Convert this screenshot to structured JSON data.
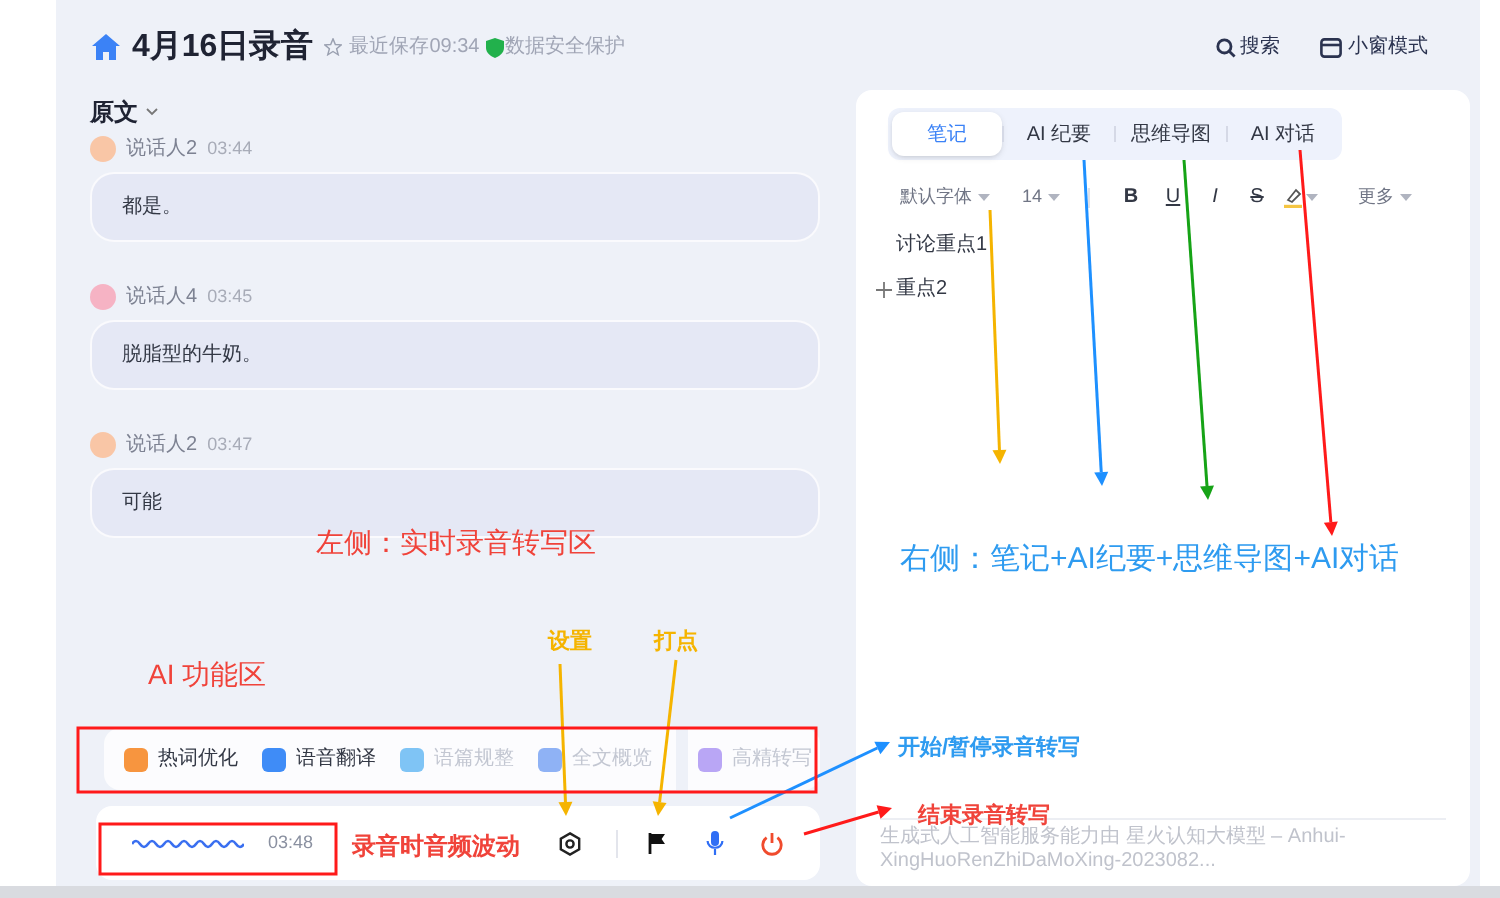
{
  "header": {
    "title": "4月16日录音",
    "saved": "最近保存09:34",
    "security": "数据安全保护",
    "search": "搜索",
    "mini_mode": "小窗模式"
  },
  "transcript": {
    "heading": "原文",
    "entries": [
      {
        "speaker": "说话人2",
        "time": "03:44",
        "text": "都是。",
        "color": "#f9c6a6"
      },
      {
        "speaker": "说话人4",
        "time": "03:45",
        "text": "脱脂型的牛奶。",
        "color": "#f6b3c4"
      },
      {
        "speaker": "说话人2",
        "time": "03:47",
        "text": "可能",
        "color": "#f9c6a6"
      }
    ]
  },
  "ai_tools": [
    {
      "label": "热词优化",
      "disabled": false,
      "color": "#f7953f"
    },
    {
      "label": "语音翻译",
      "disabled": false,
      "color": "#3f8cf7"
    },
    {
      "label": "语篇规整",
      "disabled": true,
      "color": "#7fc4f5"
    },
    {
      "label": "全文概览",
      "disabled": true,
      "color": "#8fb2f5"
    },
    {
      "label": "高精转写",
      "disabled": true,
      "color": "#b9a6f5"
    }
  ],
  "recorder": {
    "time": "03:48"
  },
  "notes": {
    "tabs": [
      {
        "label": "笔记",
        "selected": true
      },
      {
        "label": "AI 纪要",
        "selected": false
      },
      {
        "label": "思维导图",
        "selected": false
      },
      {
        "label": "AI 对话",
        "selected": false
      }
    ],
    "toolbar": {
      "font": "默认字体",
      "size": "14",
      "format": [
        "B",
        "U",
        "I",
        "S"
      ],
      "more": "更多"
    },
    "lines": [
      {
        "text": "讨论重点1",
        "kind": "plain"
      },
      {
        "text": "重点2",
        "kind": "add"
      }
    ],
    "footer": "生成式人工智能服务能力由 星火认知大模型 – Anhui-XingHuoRenZhiDaMoXing-2023082..."
  },
  "annotations": [
    {
      "text": "左侧：实时录音转写区",
      "color": "#f0433a"
    },
    {
      "text": "右侧：笔记+AI纪要+思维导图+AI对话",
      "color": "#2e9bf0"
    },
    {
      "text": "AI 功能区",
      "color": "#f0433a"
    },
    {
      "text": "设置",
      "color": "#f5b400"
    },
    {
      "text": "打点",
      "color": "#f5b400"
    },
    {
      "text": "录音时音频波动",
      "color": "#f0433a"
    },
    {
      "text": "开始/暂停录音转写",
      "color": "#2e9bf0"
    },
    {
      "text": "结束录音转写",
      "color": "#f0433a"
    }
  ]
}
